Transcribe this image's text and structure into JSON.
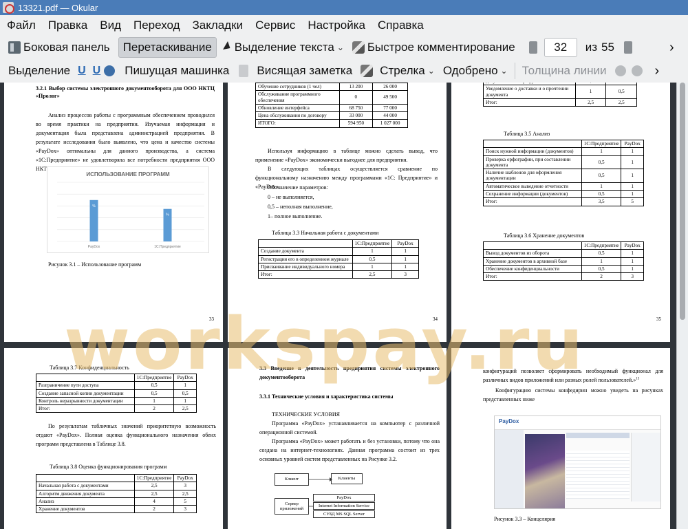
{
  "window": {
    "title": "13321.pdf  — Okular"
  },
  "menu": [
    "Файл",
    "Правка",
    "Вид",
    "Переход",
    "Закладки",
    "Сервис",
    "Настройка",
    "Справка"
  ],
  "toolbar1": {
    "sidebar": "Боковая панель",
    "drag": "Перетаскивание",
    "text_select": "Выделение текста",
    "quick_comment": "Быстрое комментирование",
    "page_current": "32",
    "page_of": "из",
    "page_total": "55",
    "more": "›"
  },
  "toolbar2": {
    "select": "Выделение",
    "u1": "U",
    "u2": "U",
    "typewriter": "Пишущая машинка",
    "sticky": "Висящая заметка",
    "arrow": "Стрелка",
    "approved": "Одобрено",
    "line_width": "Толщина линии",
    "more": "›"
  },
  "watermark": "workspay.ru",
  "p1": {
    "heading": "3.2.1 Выбор системы электронного документооборота для ООО НКТЦ «Пролог»",
    "body": "Анализ процессов работы с программным обеспечением проводился во время практики на предприятии. Изучаемая информация и документация была представлена администрацией предприятия. В результате исследования было выявлено, что цена и качество системы «PayDox» оптимальны для данного производства, а система «1С:Предприятие» не удовлетворяла все потребности предприятия ООО НКТЦ «Пролог».",
    "chart_title": "ИСПОЛЬЗОВАНИЕ ПРОГРАММ",
    "caption": "Рисунок 3.1 – Использование программ",
    "page_no": "33",
    "chart_data": {
      "type": "bar",
      "title": "ИСПОЛЬЗОВАНИЕ ПРОГРАММ",
      "categories": [
        "PayDox",
        "1С:Предприятие"
      ],
      "values": [
        70,
        55
      ],
      "data_labels": [
        "%",
        "%"
      ],
      "ylim": [
        0,
        100
      ],
      "color": "#5b9bd5"
    }
  },
  "p2": {
    "table_rows": [
      [
        "Обучение сотрудников (1 чел)",
        "13 200",
        "26 000"
      ],
      [
        "Обслуживание программного обеспечения",
        "0",
        "49 500"
      ],
      [
        "Обновление интерфейса",
        "68 750",
        "77 000"
      ],
      [
        "Цена обслуживания по договору",
        "33 000",
        "44 000"
      ],
      [
        "ИТОГО:",
        "594 950",
        "1 027 000"
      ]
    ],
    "para1": "Используя информацию в таблице можно сделать вывод, что применение «PayDox» экономически выгоднее для предприятия.",
    "para2": "В следующих таблицах осуществляется сравнение по функциональному назначению между программами «1С: Предприятие» и «PayDox».",
    "params_title": "Обозначение параметров:",
    "param0": "0 – не выполняется,",
    "param05": "0,5 – неполная выполнение,",
    "param1": "1– полное выполнение.",
    "table_caption": "Таблица 3.3 Начальная работа с документами",
    "t33_header": [
      "",
      "1С:Предприятие",
      "PayDox"
    ],
    "t33_rows": [
      [
        "Создание документа",
        "1",
        "1"
      ],
      [
        "Регистрация его в определенном журнале",
        "0,5",
        "1"
      ],
      [
        "Присваивание индивидуального номера",
        "1",
        "1"
      ],
      [
        "Итог:",
        "2,5",
        "3"
      ]
    ],
    "page_no": "34"
  },
  "p3": {
    "top_rows": [
      [
        "документов на маршруты",
        "0,5",
        "1"
      ],
      [
        "Уведомление о доставки и о прочтении документа",
        "1",
        "0,5"
      ],
      [
        "Итог:",
        "2,5",
        "2,5"
      ]
    ],
    "t35_caption": "Таблица 3.5 Анализ",
    "t35_header": [
      "",
      "1С:Предприятие",
      "PayDox"
    ],
    "t35_rows": [
      [
        "Поиск нужной информации (документов)",
        "1",
        "1"
      ],
      [
        "Проверка орфографии, при составлении документа",
        "0,5",
        "1"
      ],
      [
        "Наличие шаблонов для оформления документации",
        "0,5",
        "1"
      ],
      [
        "Автоматическое выведение отчетности",
        "1",
        "1"
      ],
      [
        "Сохранение информации (документов)",
        "0,5",
        "1"
      ],
      [
        "Итог:",
        "3,5",
        "5"
      ]
    ],
    "t36_caption": "Таблица 3.6 Хранение документов",
    "t36_header": [
      "",
      "1С:Предприятие",
      "PayDox"
    ],
    "t36_rows": [
      [
        "Вывод документов из оборота",
        "0,5",
        "1"
      ],
      [
        "Хранение документов в архивной базе",
        "1",
        "1"
      ],
      [
        "Обеспечение конфиденциальности",
        "0,5",
        "1"
      ],
      [
        "Итог:",
        "2",
        "3"
      ]
    ],
    "page_no": "35"
  },
  "p4": {
    "t37_caption": "Таблица 3.7 Конфиденциальность",
    "t37_header": [
      "",
      "1С:Предприятие",
      "PayDox"
    ],
    "t37_rows": [
      [
        "Разграничение пути доступа",
        "0,5",
        "1"
      ],
      [
        "Создание запасной копии документации",
        "0,5",
        "0,5"
      ],
      [
        "Контроль неразрывности документации",
        "1",
        "1"
      ],
      [
        "Итог:",
        "2",
        "2,5"
      ]
    ],
    "para": "По результатам табличных значений приоритетную возможность отдают «PayDox». Полная оценка функционального назначения обеих программ представлена в Таблице 3.8.",
    "t38_caption": "Таблица 3.8 Оценка функционирования программ",
    "t38_header": [
      "",
      "1С:Предприятие",
      "PayDox"
    ],
    "t38_rows": [
      [
        "Начальная работа с документами",
        "2,5",
        "3"
      ],
      [
        "Алгоритм движения документа",
        "2,5",
        "2,5"
      ],
      [
        "Анализ",
        "4",
        "5"
      ],
      [
        "Хранение документов",
        "2",
        "3"
      ]
    ]
  },
  "p5": {
    "heading": "3.3 Введение в деятельность предприятия системы электронного документооборота",
    "subheading": "3.3.1 Технические условия и характеристика системы",
    "caps": "ТЕХНИЧЕСКИЕ УСЛОВИЯ",
    "para1": "Программа «PayDox» устанавливается на компьютер с различной операционной системой.",
    "para2": "Программа «PayDox» может работать и без установки, потому что она создана на интернет-технологиях. Данная программа состоит из трех основных уровней систем представленных на Рисунке 3.2.",
    "d_client": "Клиент",
    "d_clients": "Клиенты",
    "d_server": "Сервер приложений",
    "d_paydox": "PayDox",
    "d_iis": "Internet Information Service",
    "d_sql": "СУБД MS SQL Server"
  },
  "p6": {
    "para1": "конфигураций позволяет сформировать необходимый функционал для различных видов приложений или разных ролей пользователей.»",
    "footnote_mark": "13",
    "para2": "Конфигурацию системы конфедирин можно увидеть на рисунках представленных ниже",
    "caption": "Рисунок 3.3 – Концелярия",
    "shot_logo": "PayDox"
  }
}
